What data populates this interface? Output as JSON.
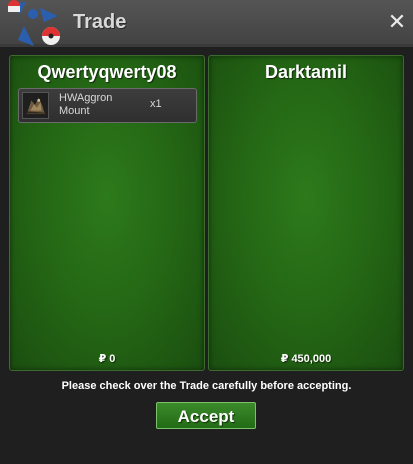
{
  "window": {
    "title": "Trade",
    "close_symbol": "✕"
  },
  "trade": {
    "left": {
      "trader_name": "Qwertyqwerty08",
      "items": [
        {
          "name": "HWAggron Mount",
          "quantity": "x1",
          "icon": "aggron-mount-icon"
        }
      ],
      "currency_symbol": "₽",
      "money": "0"
    },
    "right": {
      "trader_name": "Darktamil",
      "items": [],
      "currency_symbol": "₽",
      "money": "450,000"
    }
  },
  "footer": {
    "notice": "Please check over the Trade carefully before accepting.",
    "accept_label": "Accept"
  },
  "colors": {
    "panel_green": "#2d7a1b",
    "button_green": "#2f7d21",
    "titlebar": "#4a4a4a",
    "background": "#1f1f1f"
  }
}
